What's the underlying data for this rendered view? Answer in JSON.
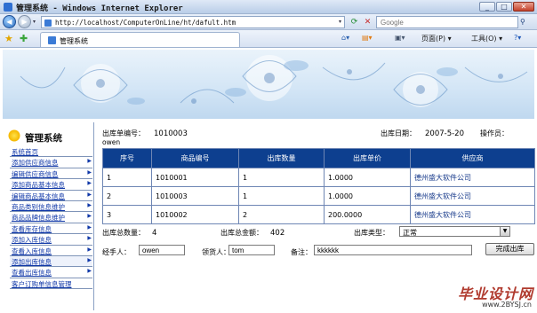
{
  "window": {
    "title": "管理系统 - Windows Internet Explorer",
    "address": "http://localhost/ComputerOnLine/ht/dafult.htm",
    "search_placeholder": "Google",
    "tab_title": "管理系统",
    "page_menu": "页面(P) ▾",
    "tools_menu": "工具(O) ▾"
  },
  "sidebar": {
    "title": "管理系统",
    "items": [
      {
        "label": "系统首页"
      },
      {
        "label": "添加供应商信息"
      },
      {
        "label": "编辑供应商信息"
      },
      {
        "label": "添加商品基本信息"
      },
      {
        "label": "编辑商品基本信息"
      },
      {
        "label": "商品类别信息维护"
      },
      {
        "label": "商品品牌信息维护"
      },
      {
        "label": "查看库存信息"
      },
      {
        "label": "添加入库信息"
      },
      {
        "label": "查看入库信息"
      },
      {
        "label": "添加出库信息"
      },
      {
        "label": "查看出库信息"
      },
      {
        "label": "客户订购单信息管理"
      }
    ]
  },
  "form": {
    "order_no_label": "出库单编号：",
    "order_no": "1010003",
    "date_label": "出库日期：",
    "date": "2007-5-20",
    "operator_label": "操作员：",
    "operator": "owen",
    "columns": [
      "序号",
      "商品编号",
      "出库数量",
      "出库单价",
      "供应商"
    ],
    "rows": [
      [
        "1",
        "1010001",
        "1",
        "1.0000",
        "德州盛大软件公司"
      ],
      [
        "2",
        "1010003",
        "1",
        "1.0000",
        "德州盛大软件公司"
      ],
      [
        "3",
        "1010002",
        "2",
        "200.0000",
        "德州盛大软件公司"
      ]
    ],
    "total_qty_label": "出库总数量：",
    "total_qty": "4",
    "total_amount_label": "出库总金额：",
    "total_amount": "402",
    "type_label": "出库类型：",
    "type_value": "正常",
    "handler_label": "经手人：",
    "handler": "owen",
    "responsible_label": "领货人：",
    "responsible": "tom",
    "remark_label": "备注：",
    "remark": "kkkkkk",
    "finish_button": "完成出库"
  },
  "watermark": {
    "main": "毕业设计网",
    "sub": "www.2BYSJ.cn"
  },
  "colors": {
    "table_header": "#0d3f8f",
    "sidebar_link": "#1038a8",
    "watermark": "#b03a2e"
  }
}
